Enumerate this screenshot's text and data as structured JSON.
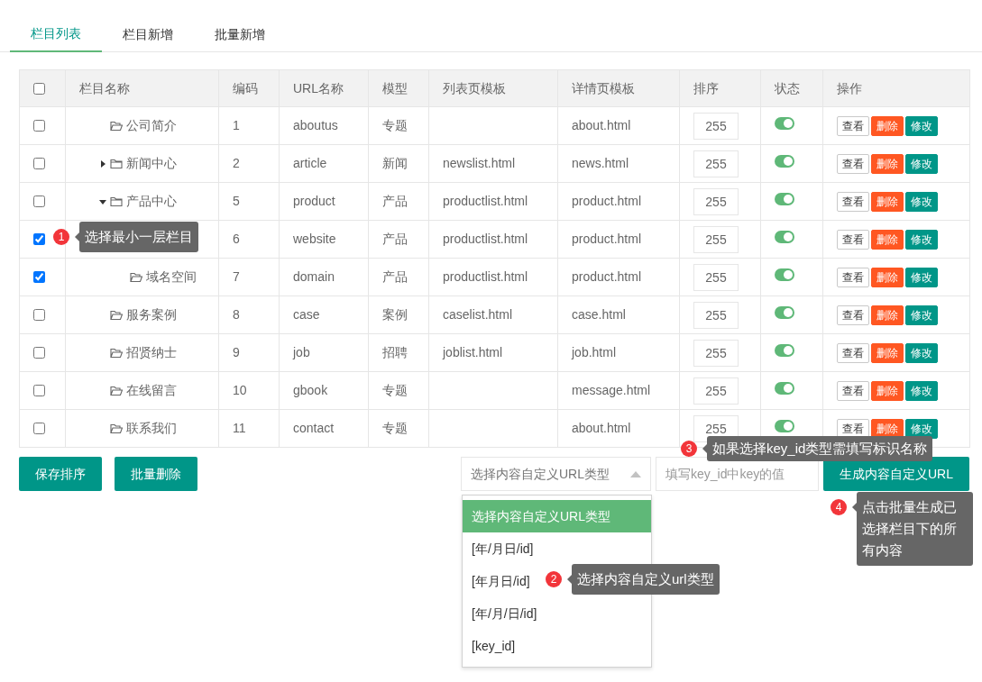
{
  "tabs": [
    {
      "label": "栏目列表",
      "selected": true
    },
    {
      "label": "栏目新增",
      "selected": false
    },
    {
      "label": "批量新增",
      "selected": false
    }
  ],
  "table": {
    "columns": [
      "栏目名称",
      "编码",
      "URL名称",
      "模型",
      "列表页模板",
      "详情页模板",
      "排序",
      "状态",
      "操作"
    ],
    "header_checked": false,
    "rows": [
      {
        "checked": false,
        "name": "公司简介",
        "code": "1",
        "url": "aboutus",
        "model": "专题",
        "list_tpl": "",
        "detail_tpl": "about.html",
        "sort": "255",
        "on": true,
        "actions": [
          "查看",
          "删除",
          "修改"
        ]
      },
      {
        "checked": false,
        "name": "新闻中心",
        "code": "2",
        "url": "article",
        "model": "新闻",
        "list_tpl": "newslist.html",
        "detail_tpl": "news.html",
        "sort": "255",
        "on": true,
        "actions": [
          "查看",
          "删除",
          "修改"
        ],
        "expanded": false
      },
      {
        "checked": false,
        "name": "产品中心",
        "code": "5",
        "url": "product",
        "model": "产品",
        "list_tpl": "productlist.html",
        "detail_tpl": "product.html",
        "sort": "255",
        "on": true,
        "actions": [
          "查看",
          "删除",
          "修改"
        ],
        "expanded": true,
        "children": [
          {
            "checked": true,
            "code": "6",
            "url": "website",
            "model": "产品",
            "list_tpl": "productlist.html",
            "detail_tpl": "product.html",
            "sort": "255",
            "on": true,
            "actions": [
              "查看",
              "删除",
              "修改"
            ]
          },
          {
            "checked": true,
            "name": "域名空间",
            "code": "7",
            "url": "domain",
            "model": "产品",
            "list_tpl": "productlist.html",
            "detail_tpl": "product.html",
            "sort": "255",
            "on": true,
            "actions": [
              "查看",
              "删除",
              "修改"
            ]
          }
        ]
      },
      {
        "checked": false,
        "name": "服务案例",
        "code": "8",
        "url": "case",
        "model": "案例",
        "list_tpl": "caselist.html",
        "detail_tpl": "case.html",
        "sort": "255",
        "on": true,
        "actions": [
          "查看",
          "删除",
          "修改"
        ]
      },
      {
        "checked": false,
        "name": "招贤纳士",
        "code": "9",
        "url": "job",
        "model": "招聘",
        "list_tpl": "joblist.html",
        "detail_tpl": "job.html",
        "sort": "255",
        "on": true,
        "actions": [
          "查看",
          "删除",
          "修改"
        ]
      },
      {
        "checked": false,
        "name": "在线留言",
        "code": "10",
        "url": "gbook",
        "model": "专题",
        "list_tpl": "",
        "detail_tpl": "message.html",
        "sort": "255",
        "on": true,
        "actions": [
          "查看",
          "删除",
          "修改"
        ]
      },
      {
        "checked": false,
        "name": "联系我们",
        "code": "11",
        "url": "contact",
        "model": "专题",
        "list_tpl": "",
        "detail_tpl": "about.html",
        "sort": "255",
        "on": true,
        "actions": [
          "查看",
          "删除",
          "修改"
        ]
      }
    ]
  },
  "bottom_buttons": [
    "保存排序",
    "批量删除"
  ],
  "url_type_select": {
    "placeholder": "选择内容自定义URL类型",
    "expanded": true,
    "options": [
      {
        "label": "选择内容自定义URL类型",
        "selected": true
      },
      {
        "label": "[年/月日/id]",
        "selected": false
      },
      {
        "label": "[年月日/id]",
        "selected": false
      },
      {
        "label": "[年/月/日/id]",
        "selected": false
      },
      {
        "label": "[key_id]",
        "selected": false
      }
    ]
  },
  "key_field": {
    "placeholder": "填写key_id中key的值"
  },
  "generate_button": "生成内容自定义URL",
  "tips": [
    {
      "number": "1",
      "text": "选择最小一层栏目"
    },
    {
      "number": "2",
      "text": "选择内容自定义url类型"
    },
    {
      "number": "3",
      "text": "如果选择key_id类型需填写标识名称"
    },
    {
      "number": "4",
      "text": "点击批量生成已选择栏目下的所有内容"
    }
  ]
}
